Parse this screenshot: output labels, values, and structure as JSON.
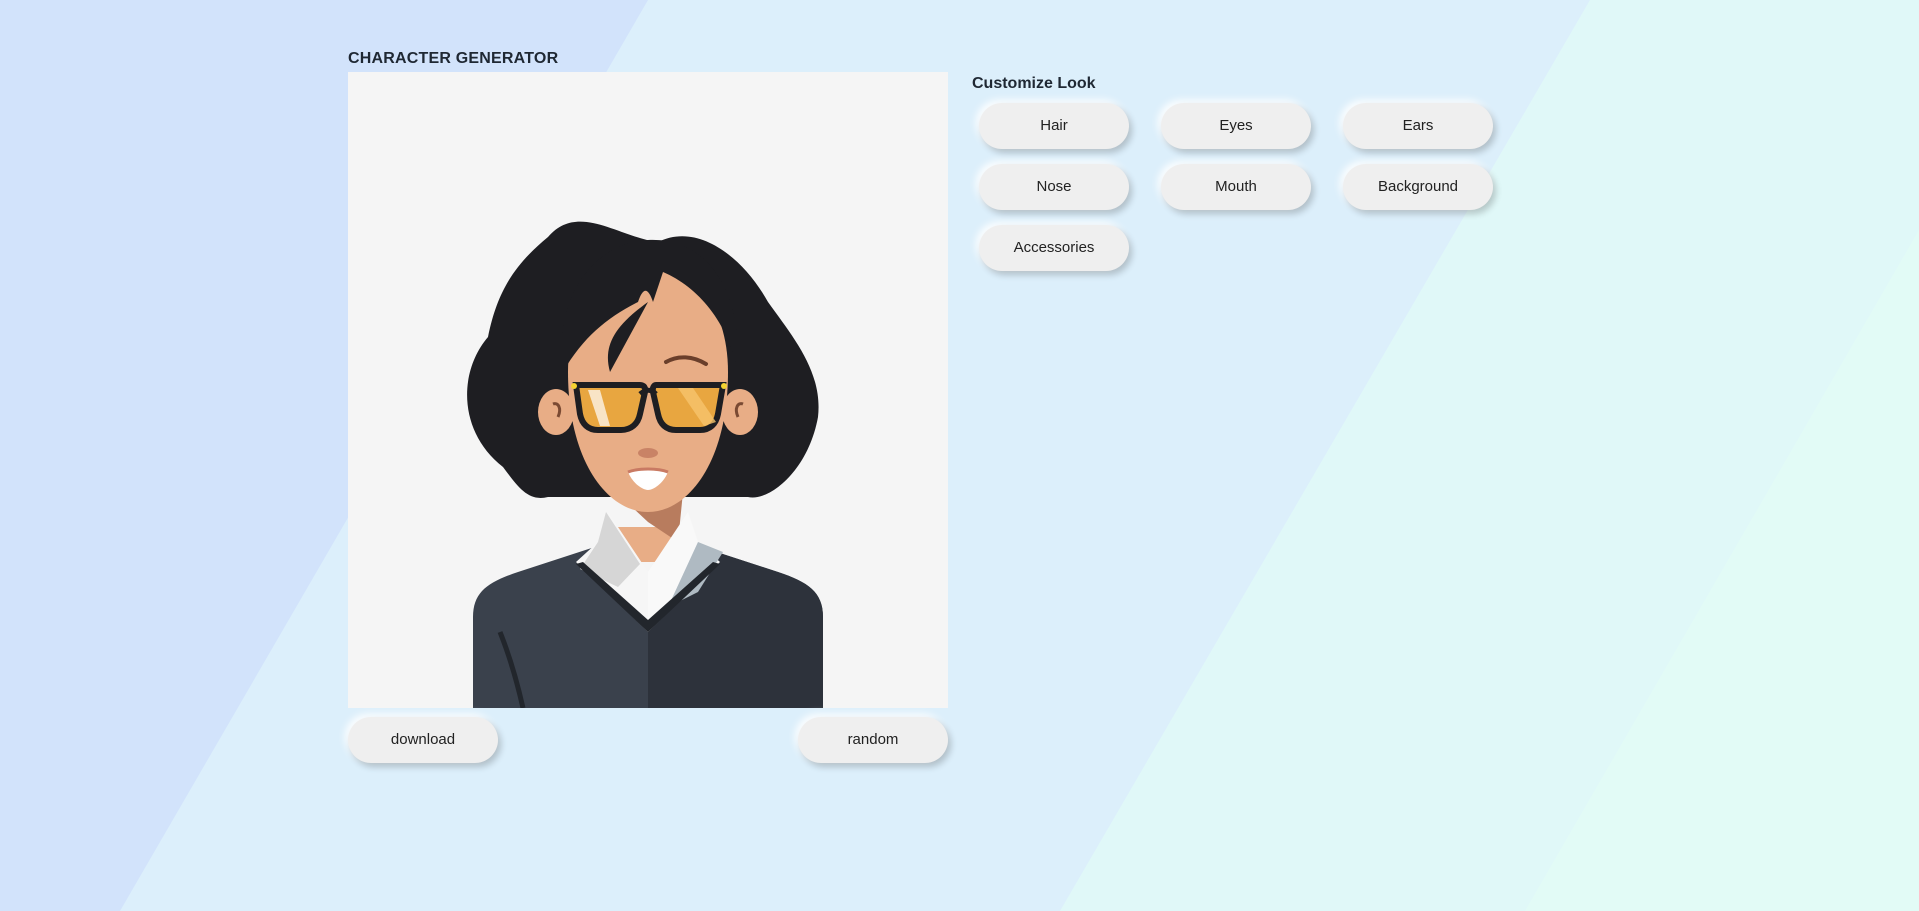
{
  "app": {
    "title": "CHARACTER GENERATOR"
  },
  "preview": {
    "accent_glasses": "#e8a640",
    "hair_color": "#1e1e22",
    "skin_color": "#e8ad86",
    "sweater_color": "#3a414c"
  },
  "actions": {
    "download_label": "download",
    "random_label": "random"
  },
  "customize": {
    "title": "Customize Look",
    "options": [
      "Hair",
      "Eyes",
      "Ears",
      "Nose",
      "Mouth",
      "Background",
      "Accessories"
    ]
  },
  "colors": {
    "canvas_bg": "#f5f5f5",
    "button_bg": "#efefef",
    "bg_blue": "#d2e3fb",
    "bg_mid": "#dbf0fb",
    "bg_cyan": "#e0f8f8"
  }
}
